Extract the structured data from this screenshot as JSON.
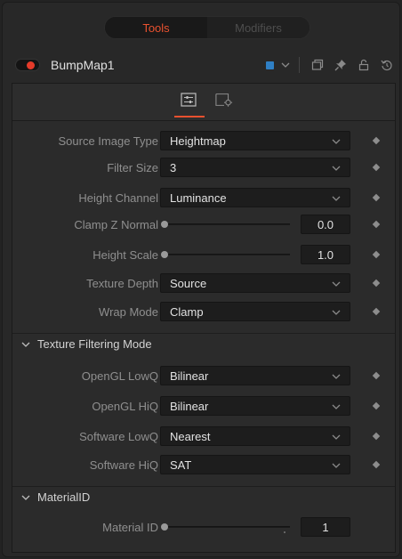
{
  "top_tabs": [
    {
      "label": "Tools",
      "active": true
    },
    {
      "label": "Modifiers",
      "active": false
    }
  ],
  "header": {
    "node_name": "BumpMap1",
    "toggle_color": "#e53b2a",
    "swatch_color": "#2f7fc4",
    "icons": [
      "chevron-down-icon",
      "window-icon",
      "pin-icon",
      "lock-icon",
      "reset-icon"
    ]
  },
  "subtabs": [
    {
      "icon": "controls-icon",
      "active": true
    },
    {
      "icon": "settings-icon",
      "active": false
    }
  ],
  "controls": {
    "source_image_type": {
      "label": "Source Image Type",
      "value": "Heightmap"
    },
    "filter_size": {
      "label": "Filter Size",
      "value": "3"
    },
    "height_channel": {
      "label": "Height Channel",
      "value": "Luminance"
    },
    "clamp_z_normal": {
      "label": "Clamp Z Normal",
      "value": "0.0"
    },
    "height_scale": {
      "label": "Height Scale",
      "value": "1.0"
    },
    "texture_depth": {
      "label": "Texture Depth",
      "value": "Source"
    },
    "wrap_mode": {
      "label": "Wrap Mode",
      "value": "Clamp"
    }
  },
  "texture_filtering": {
    "title": "Texture Filtering Mode",
    "opengl_lowq": {
      "label": "OpenGL LowQ",
      "value": "Bilinear"
    },
    "opengl_hiq": {
      "label": "OpenGL HiQ",
      "value": "Bilinear"
    },
    "software_lowq": {
      "label": "Software LowQ",
      "value": "Nearest"
    },
    "software_hiq": {
      "label": "Software HiQ",
      "value": "SAT"
    }
  },
  "material": {
    "title": "MaterialID",
    "material_id": {
      "label": "Material ID",
      "value": "1"
    }
  },
  "colors": {
    "accent": "#e8512f",
    "panel": "#2b2b2b",
    "field": "#1d1d1d"
  }
}
